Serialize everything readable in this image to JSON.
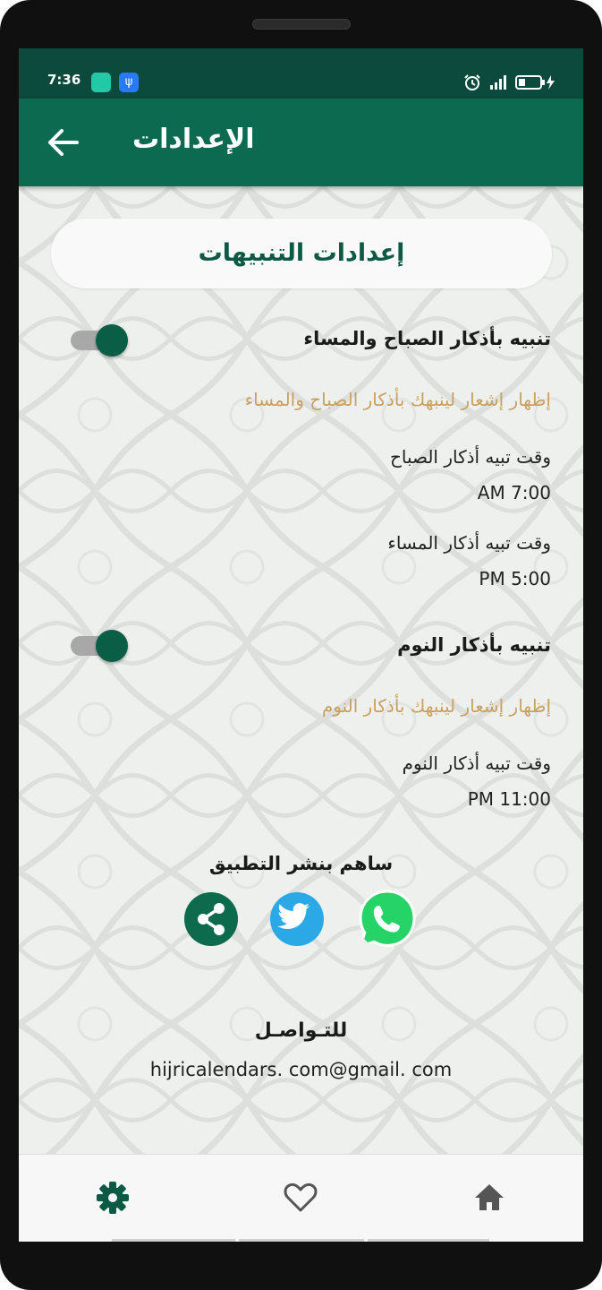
{
  "status_bar": {
    "time": "7:36"
  },
  "app_bar": {
    "title": "الإعدادات"
  },
  "section": {
    "title": "إعدادات التنبيهات"
  },
  "morning_evening": {
    "title": "تنبيه بأذكار الصباح والمساء",
    "enabled": true,
    "subtitle": "إظهار إشعار لينبهك بأذكار الصباح والمساء",
    "morning_label": "وقت تبيه أذكار الصباح",
    "morning_time": "AM 7:00",
    "evening_label": "وقت تبيه أذكار المساء",
    "evening_time": "PM 5:00"
  },
  "sleep": {
    "title": "تنبيه بأذكار النوم",
    "enabled": true,
    "subtitle": "إظهار إشعار لينبهك بأذكار النوم",
    "label": "وقت تبيه أذكار النوم",
    "time": "PM 11:00"
  },
  "share": {
    "label": "ساهم بنشر التطبيق",
    "icons": [
      "share-icon",
      "twitter-icon",
      "whatsapp-icon"
    ]
  },
  "contact": {
    "label": "للتـواصـل",
    "email": "hijricalendars. com@gmail. com"
  },
  "bottom_nav": {
    "items": [
      "settings-icon",
      "heart-icon",
      "home-icon"
    ],
    "active": "settings-icon"
  },
  "colors": {
    "primary": "#0c6a50",
    "status_bar": "#0b4a3c",
    "accent_gold": "#c9a062",
    "twitter": "#2ba9e6",
    "whatsapp": "#25d366"
  }
}
